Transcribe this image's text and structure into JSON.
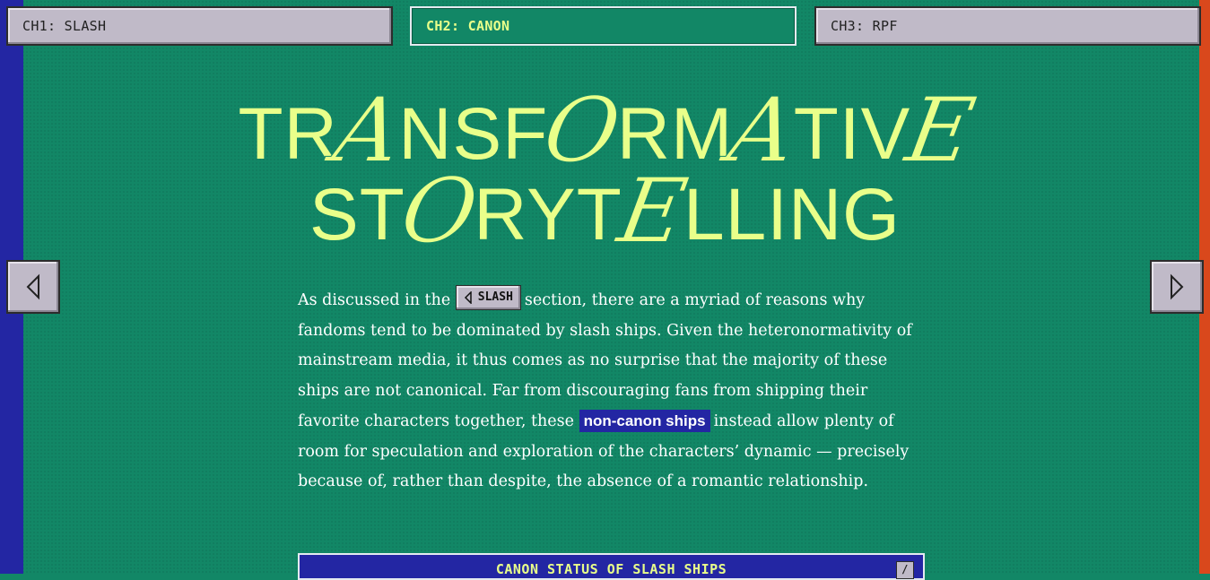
{
  "tabs": [
    {
      "label": "CH1: SLASH"
    },
    {
      "label": "CH2: CANON"
    },
    {
      "label": "CH3: RPF"
    }
  ],
  "title": {
    "line1": [
      "TR",
      "A",
      "NSF",
      "O",
      "RM",
      "A",
      "TIV",
      "E"
    ],
    "line2": [
      "ST",
      "O",
      "RYT",
      "E",
      "LLING"
    ]
  },
  "nav": {
    "prev_icon": "triangle-left-icon",
    "next_icon": "triangle-right-icon"
  },
  "paragraph": {
    "part1": "As discussed in the ",
    "chip_label": "SLASH",
    "part2": "section, there are a myriad of reasons why fandoms tend to be dominated by slash ships. Given the heteronormativity of mainstream media, it thus comes as no surprise that the majority of these ships are not canonical. Far from discouraging fans from shipping their favorite characters together, these ",
    "highlight": "non-canon ships",
    "part3": "instead allow plenty of room for speculation and exploration of the characters’ dynamic — precisely because of, rather than despite, the absence of a romantic relationship."
  },
  "panel": {
    "title": "CANON STATUS OF SLASH SHIPS",
    "button": "/"
  },
  "colors": {
    "bg": "#128766",
    "accent": "#e9ff8a",
    "blue": "#2326a3",
    "orange": "#d9481c",
    "chrome": "#c0bac8"
  }
}
